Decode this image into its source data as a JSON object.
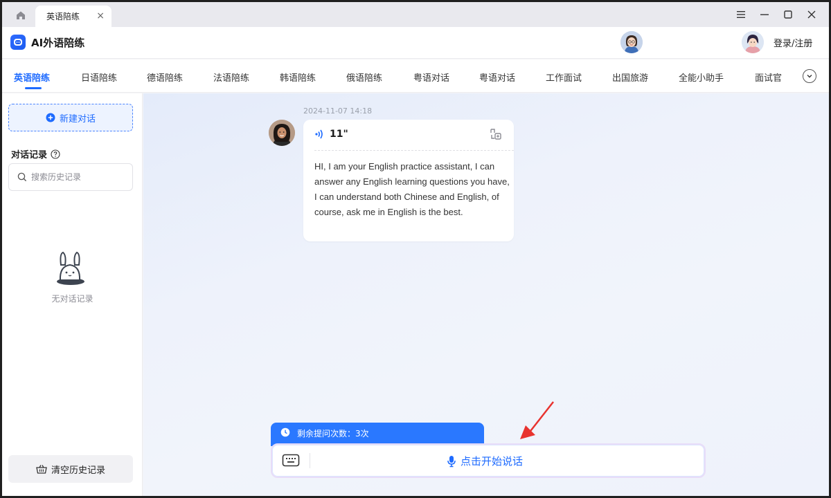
{
  "tabstrip": {
    "tab_title": "英语陪练",
    "close_glyph": "×"
  },
  "header": {
    "app_title": "AI外语陪练",
    "login_label": "登录/注册"
  },
  "lang_tabs": [
    {
      "label": "英语陪练",
      "active": true
    },
    {
      "label": "日语陪练",
      "active": false
    },
    {
      "label": "德语陪练",
      "active": false
    },
    {
      "label": "法语陪练",
      "active": false
    },
    {
      "label": "韩语陪练",
      "active": false
    },
    {
      "label": "俄语陪练",
      "active": false
    },
    {
      "label": "粤语对话",
      "active": false
    },
    {
      "label": "粤语对话",
      "active": false
    },
    {
      "label": "工作面试",
      "active": false
    },
    {
      "label": "出国旅游",
      "active": false
    },
    {
      "label": "全能小助手",
      "active": false
    },
    {
      "label": "面试官",
      "active": false
    }
  ],
  "sidebar": {
    "new_chat_label": "新建对话",
    "history_title": "对话记录",
    "search_placeholder": "搜索历史记录",
    "empty_text": "无对话记录",
    "clear_label": "清空历史记录"
  },
  "chat": {
    "timestamp": "2024-11-07 14:18",
    "duration": "11\"",
    "message": "HI, I am your English practice assistant, I can answer any English learning questions you have, I can understand both Chinese and English, of course, ask me in English is the best."
  },
  "composer": {
    "quota_text": "剩余提问次数：3次",
    "speak_label": "点击开始说话"
  },
  "colors": {
    "accent": "#1e6bff",
    "quota_bg": "#2a78ff",
    "annotation_arrow": "#e8332f"
  },
  "icons": {
    "home": "home-icon",
    "menu": "menu-icon",
    "minimize": "minimize-icon",
    "maximize": "maximize-icon",
    "close": "close-icon",
    "plus": "plus-circle-icon",
    "help": "question-circle-icon",
    "search": "search-icon",
    "empty": "bunny-empty-icon",
    "clear": "basket-icon",
    "sound": "sound-wave-icon",
    "translate": "translate-icon",
    "clock": "clock-icon",
    "keyboard": "keyboard-icon",
    "mic": "microphone-icon",
    "chevron": "chevron-down-icon"
  }
}
